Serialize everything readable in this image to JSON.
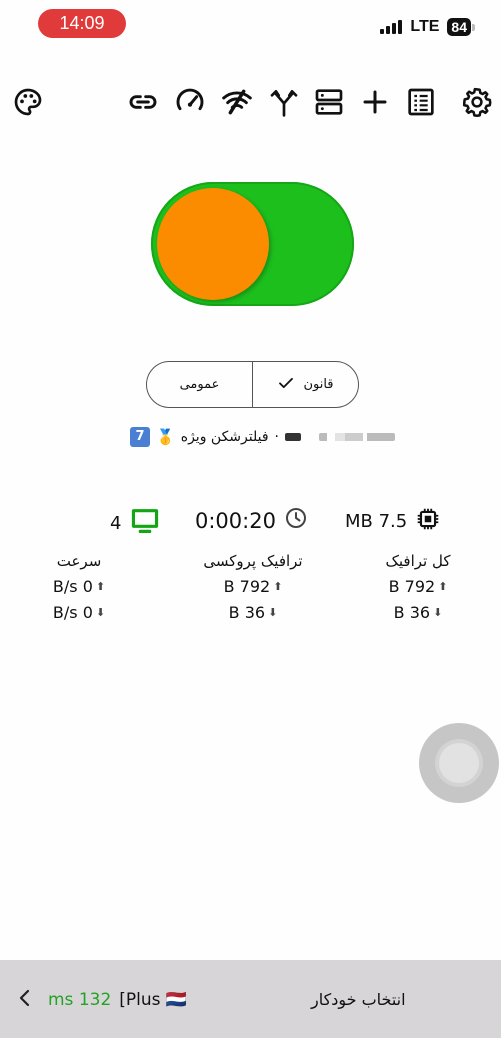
{
  "status": {
    "time": "14:09",
    "network": "LTE",
    "battery": "84"
  },
  "toolbar": {
    "icons": [
      "palette-icon",
      "link-icon",
      "speed-icon",
      "wifi-off-icon",
      "fork-icon",
      "server-icon",
      "add-icon",
      "list-icon",
      "settings-icon"
    ]
  },
  "toggle": {
    "on": true,
    "track_color": "#1dbf1d",
    "knob_color": "#fb8c00"
  },
  "mode": {
    "rule_label": "قانون",
    "global_label": "عمومی",
    "selected": "rule"
  },
  "profile": {
    "name": "فیلترشکن ویژه",
    "separator": "·",
    "badge": "🥇",
    "number_badge": "7"
  },
  "stats": {
    "memory": "MB 7.5",
    "uptime": "0:00:20",
    "connections": "4"
  },
  "columns": {
    "total": {
      "title": "کل ترافیک",
      "upload": "B 792",
      "download": "B 36"
    },
    "proxy": {
      "title": "ترافیک پروکسی",
      "upload": "B 792",
      "download": "B 36"
    },
    "speed": {
      "title": "سرعت",
      "upload": "B/s 0",
      "download": "B/s 0"
    }
  },
  "bottom": {
    "label": "انتخاب خودکار",
    "server": "[Plus 🇳🇱",
    "ping": "ms 132"
  }
}
